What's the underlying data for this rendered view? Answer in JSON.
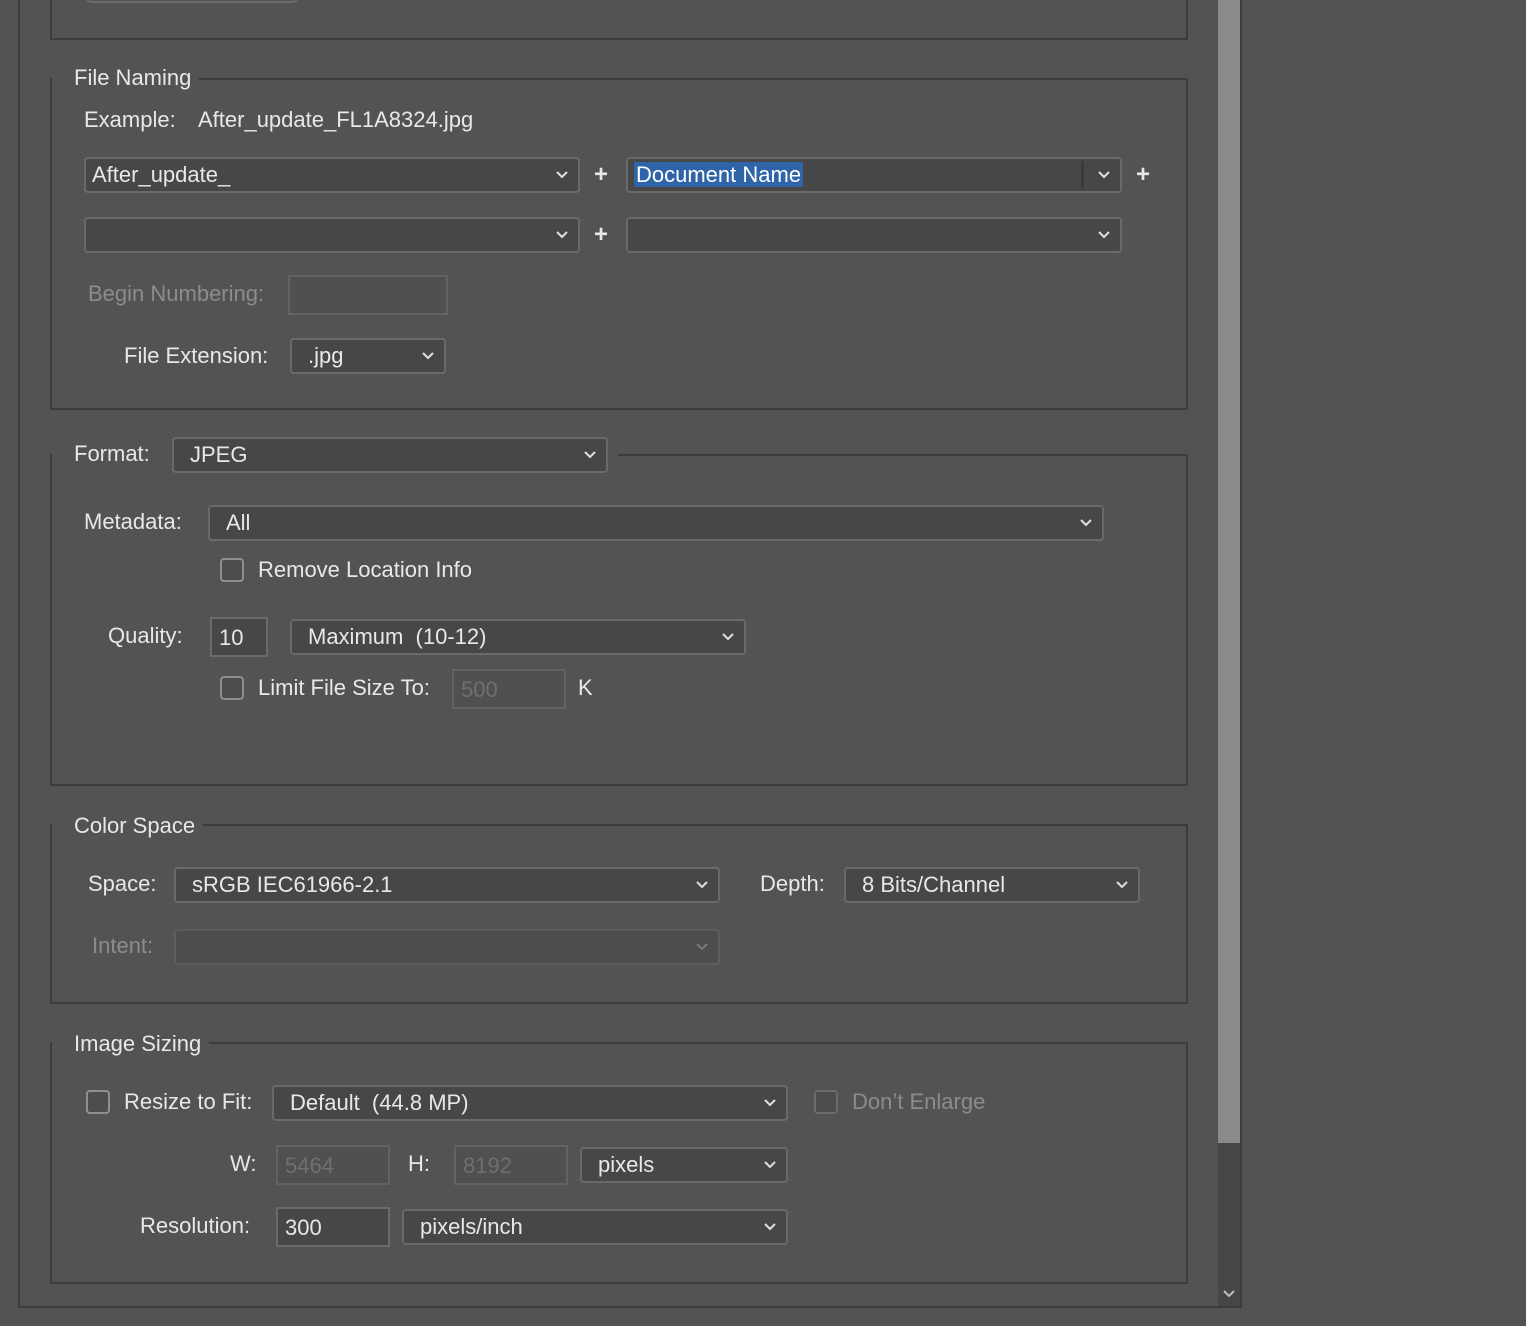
{
  "file_naming": {
    "legend": "File Naming",
    "example_label": "Example:",
    "example_value": "After_update_FL1A8324.jpg",
    "name_part1": "After_update_",
    "name_part2": "Document Name",
    "name_part3": "",
    "name_part4": "",
    "plus": "+",
    "begin_numbering_label": "Begin Numbering:",
    "begin_numbering_value": "",
    "file_extension_label": "File Extension:",
    "file_extension_value": ".jpg"
  },
  "format": {
    "label": "Format:",
    "value": "JPEG",
    "metadata_label": "Metadata:",
    "metadata_value": "All",
    "remove_location_label": "Remove Location Info",
    "quality_label": "Quality:",
    "quality_value": "10",
    "quality_preset": "Maximum  (10-12)",
    "limit_label": "Limit File Size To:",
    "limit_value": "500",
    "limit_unit": "K"
  },
  "color_space": {
    "legend": "Color Space",
    "space_label": "Space:",
    "space_value": "sRGB IEC61966-2.1",
    "depth_label": "Depth:",
    "depth_value": "8 Bits/Channel",
    "intent_label": "Intent:",
    "intent_value": ""
  },
  "image_sizing": {
    "legend": "Image Sizing",
    "resize_label": "Resize to Fit:",
    "resize_value": "Default  (44.8 MP)",
    "dont_enlarge_label": "Don’t Enlarge",
    "w_label": "W:",
    "w_value": "5464",
    "h_label": "H:",
    "h_value": "8192",
    "size_unit": "pixels",
    "resolution_label": "Resolution:",
    "resolution_value": "300",
    "resolution_unit": "pixels/inch"
  },
  "colors": {
    "background": "#535353",
    "field": "#474747",
    "border": "#6a6a6a",
    "selection": "#2f64a8",
    "text": "#e8e8e8",
    "disabled_text": "#8c8c8c"
  }
}
